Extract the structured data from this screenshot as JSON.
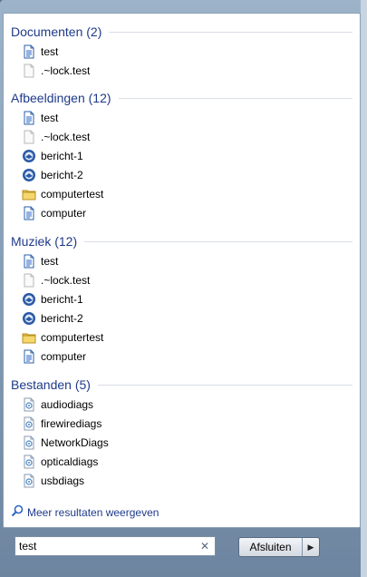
{
  "sections": [
    {
      "header": "Documenten (2)",
      "items": [
        {
          "label": "test",
          "icon": "document-icon"
        },
        {
          "label": ".~lock.test",
          "icon": "blank-file-icon"
        }
      ]
    },
    {
      "header": "Afbeeldingen (12)",
      "items": [
        {
          "label": "test",
          "icon": "document-icon"
        },
        {
          "label": ".~lock.test",
          "icon": "blank-file-icon"
        },
        {
          "label": "bericht-1",
          "icon": "thunderbird-icon"
        },
        {
          "label": "bericht-2",
          "icon": "thunderbird-icon"
        },
        {
          "label": "computertest",
          "icon": "folder-icon"
        },
        {
          "label": "computer",
          "icon": "document-icon"
        }
      ]
    },
    {
      "header": "Muziek (12)",
      "items": [
        {
          "label": "test",
          "icon": "document-icon"
        },
        {
          "label": ".~lock.test",
          "icon": "blank-file-icon"
        },
        {
          "label": "bericht-1",
          "icon": "thunderbird-icon"
        },
        {
          "label": "bericht-2",
          "icon": "thunderbird-icon"
        },
        {
          "label": "computertest",
          "icon": "folder-icon"
        },
        {
          "label": "computer",
          "icon": "document-icon"
        }
      ]
    },
    {
      "header": "Bestanden (5)",
      "items": [
        {
          "label": "audiodiags",
          "icon": "diag-file-icon"
        },
        {
          "label": "firewirediags",
          "icon": "diag-file-icon"
        },
        {
          "label": "NetworkDiags",
          "icon": "diag-file-icon"
        },
        {
          "label": "opticaldiags",
          "icon": "diag-file-icon"
        },
        {
          "label": "usbdiags",
          "icon": "diag-file-icon"
        }
      ]
    }
  ],
  "more_results": "Meer resultaten weergeven",
  "search": {
    "value": "test"
  },
  "shutdown_label": "Afsluiten",
  "colors": {
    "header": "#1e3a8a",
    "accent": "#2b66c6"
  }
}
